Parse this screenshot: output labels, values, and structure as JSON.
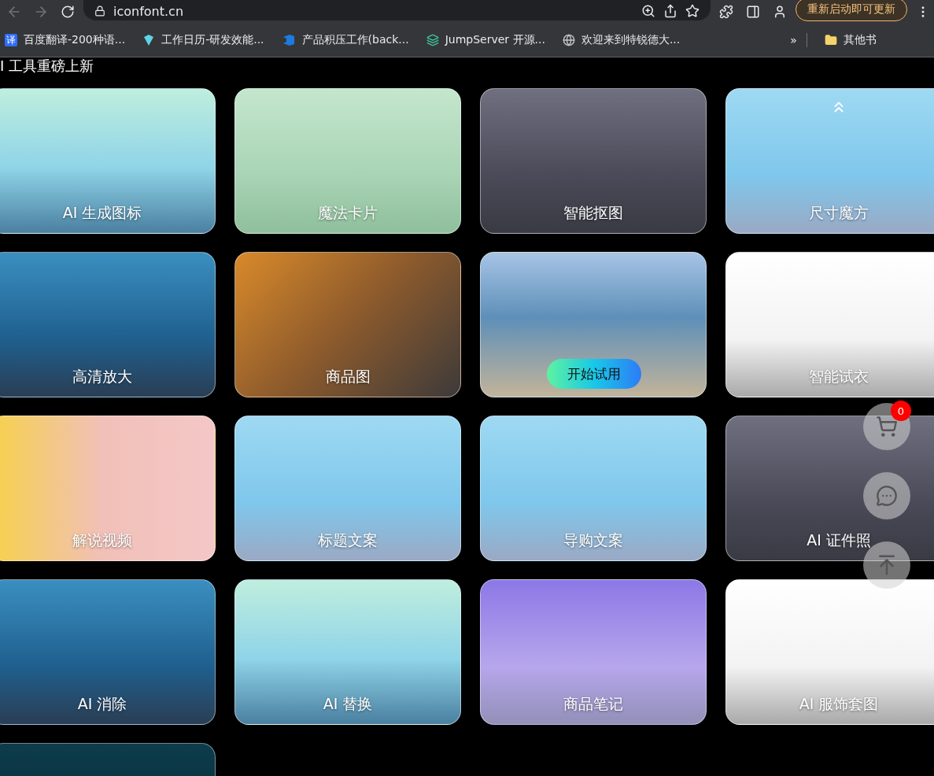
{
  "browser": {
    "address": "iconfont.cn",
    "update_button": "重新启动即可更新",
    "bookmarks": [
      {
        "kind": "translate",
        "icon_text": "译",
        "label": "百度翻译-200种语..."
      },
      {
        "kind": "diamond",
        "label": "工作日历-研发效能..."
      },
      {
        "kind": "azure",
        "label": "产品积压工作(back..."
      },
      {
        "kind": "layers",
        "label": "JumpServer 开源..."
      },
      {
        "kind": "globe",
        "label": "欢迎来到特锐德大..."
      }
    ],
    "overflow": "»",
    "other_folder": "其他书"
  },
  "section_title": "I 工具重磅上新",
  "cards": [
    {
      "label": "AI 生成图标"
    },
    {
      "label": "魔法卡片"
    },
    {
      "label": "智能抠图"
    },
    {
      "label": "尺寸魔方",
      "top_chevron": true
    },
    {
      "label": "高清放大"
    },
    {
      "label": "商品图"
    },
    {
      "button": "开始试用"
    },
    {
      "label": "智能试衣"
    },
    {
      "label": "解说视频"
    },
    {
      "label": "标题文案"
    },
    {
      "label": "导购文案"
    },
    {
      "label": "AI 证件照"
    },
    {
      "label": "AI 消除"
    },
    {
      "label": "AI 替换"
    },
    {
      "label": "商品笔记"
    },
    {
      "label": "AI 服饰套图"
    }
  ],
  "floating": {
    "cart_count": "0"
  }
}
